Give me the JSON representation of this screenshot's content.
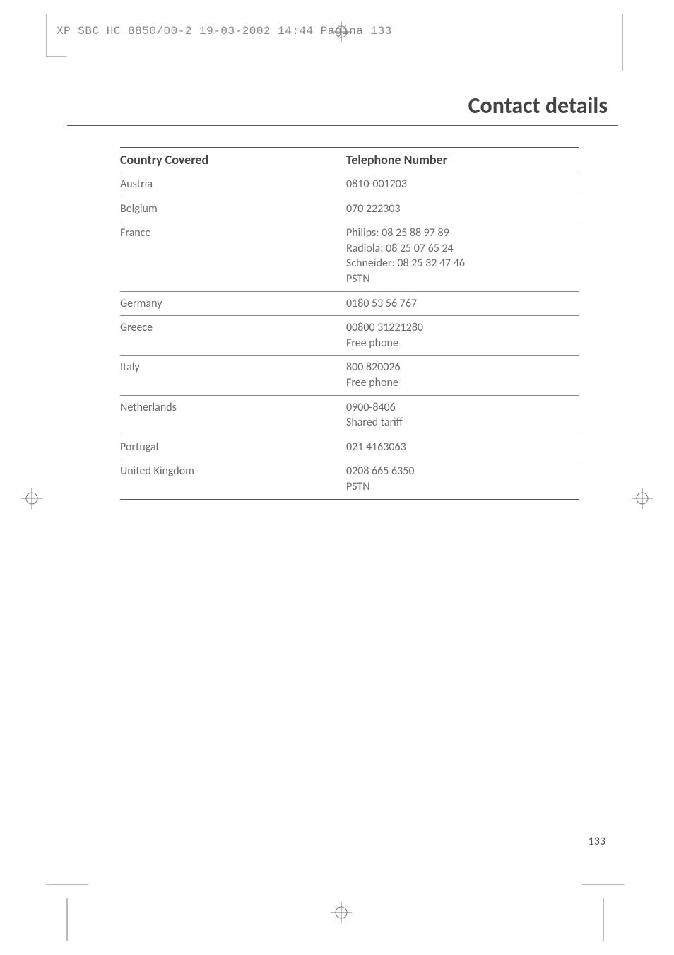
{
  "header": {
    "imposition_line": "XP SBC HC 8850/00-2  19-03-2002 14:44  Pagina 133"
  },
  "page": {
    "title": "Contact details",
    "number": "133"
  },
  "table": {
    "headers": {
      "country": "Country Covered",
      "phone": "Telephone Number"
    },
    "rows": [
      {
        "country": "Austria",
        "phone": "0810-001203"
      },
      {
        "country": "Belgium",
        "phone": "070 222303"
      },
      {
        "country": "France",
        "phone": "Philips: 08 25 88 97 89\nRadiola: 08 25 07 65 24\nSchneider: 08 25 32 47 46\nPSTN"
      },
      {
        "country": "Germany",
        "phone": "0180 53 56 767"
      },
      {
        "country": "Greece",
        "phone": "00800 31221280\nFree phone"
      },
      {
        "country": "Italy",
        "phone": "800 820026\nFree phone"
      },
      {
        "country": "Netherlands",
        "phone": "0900-8406\nShared tariff"
      },
      {
        "country": "Portugal",
        "phone": "021 4163063"
      },
      {
        "country": "United Kingdom",
        "phone": "0208 665 6350\nPSTN"
      }
    ]
  }
}
